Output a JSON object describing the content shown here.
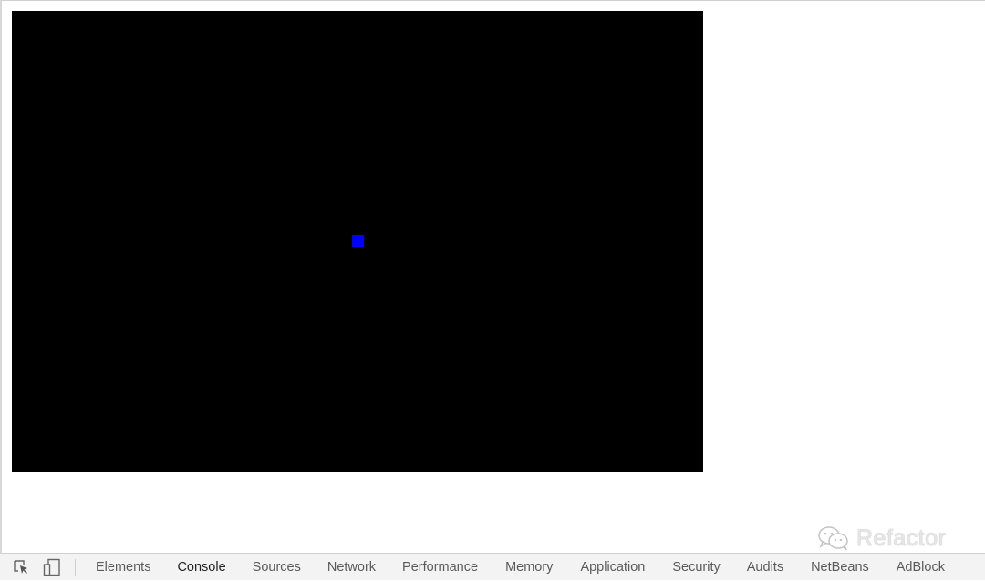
{
  "game": {
    "background_color": "#000000",
    "player_color": "#0000ff"
  },
  "watermark": {
    "text": "Refactor",
    "icon": "wechat-icon"
  },
  "devtools": {
    "icons": [
      "inspect-element-icon",
      "device-toolbar-icon"
    ],
    "active_tab": "Console",
    "tabs": [
      {
        "label": "Elements"
      },
      {
        "label": "Console"
      },
      {
        "label": "Sources"
      },
      {
        "label": "Network"
      },
      {
        "label": "Performance"
      },
      {
        "label": "Memory"
      },
      {
        "label": "Application"
      },
      {
        "label": "Security"
      },
      {
        "label": "Audits"
      },
      {
        "label": "NetBeans"
      },
      {
        "label": "AdBlock"
      }
    ]
  }
}
